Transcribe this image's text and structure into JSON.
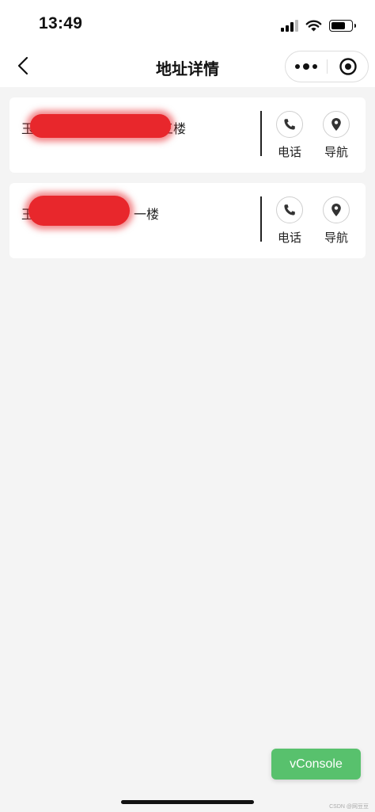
{
  "status_bar": {
    "time": "13:49"
  },
  "nav": {
    "title": "地址详情",
    "back_icon": "chevron-left-icon",
    "more_icon": "more-dots-icon",
    "home_icon": "target-icon"
  },
  "addresses": [
    {
      "prefix": "玉",
      "suffix": "三楼",
      "phone_label": "电话",
      "nav_label": "导航"
    },
    {
      "prefix": "玉环",
      "suffix": "一楼",
      "phone_label": "电话",
      "nav_label": "导航"
    }
  ],
  "vconsole": {
    "label": "vConsole"
  },
  "watermark": "CSDN @网豆豆",
  "colors": {
    "accent": "#58c16d",
    "redaction": "#e8272c",
    "background": "#f4f4f4"
  }
}
